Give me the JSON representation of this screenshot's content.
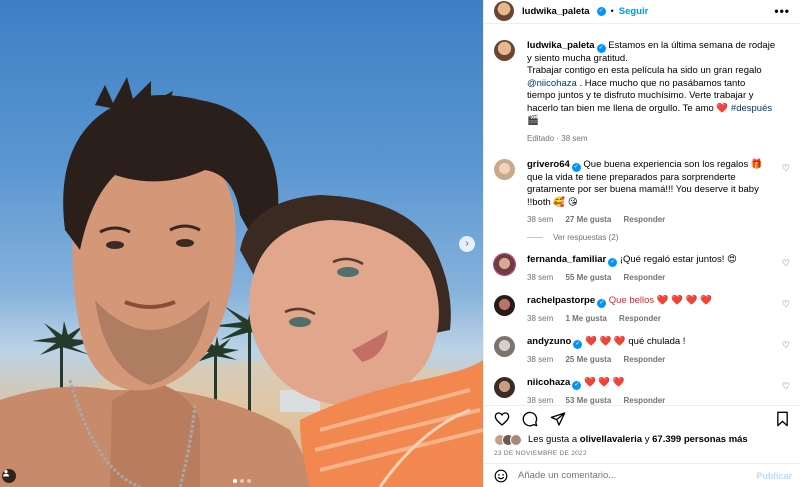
{
  "post": {
    "author": "ludwika_paleta",
    "separator": "•",
    "follow_label": "Seguir",
    "more_label": "•••",
    "caption_parts": {
      "text1": "Estamos en la última semana de rodaje y siento mucha gratitud.",
      "text2": "Trabajar contigo en esta película ha sido un gran regalo",
      "mention": "@niicohaza",
      "text3": ". Hace mucho que no pasábamos tanto tiempo juntos y te disfruto muchísimo. Verte trabajar y hacerlo tan bien me llena de orgullo. Te amo",
      "heart": "❤️",
      "hashtag": "#después",
      "emoji": "🎬"
    },
    "caption_meta": "Editado · 38 sem"
  },
  "comments": [
    {
      "user": "grivero64",
      "text": "Que buena experiencia son los regalos 🎁 que la vida te tiene preparados para sorprenderte gratamente por ser buena mamá!!! You deserve it baby !!both 🥰 😘",
      "time": "38 sem",
      "likes": "27 Me gusta",
      "reply": "Responder",
      "replies": "Ver respuestas (2)"
    },
    {
      "user": "fernanda_familiar",
      "text": "¡Qué regaló estar juntos! 😍",
      "time": "38 sem",
      "likes": "55 Me gusta",
      "reply": "Responder"
    },
    {
      "user": "rachelpastorpe",
      "text": "Que bellos ❤️ ❤️ ❤️ ❤️",
      "time": "38 sem",
      "likes": "1 Me gusta",
      "reply": "Responder"
    },
    {
      "user": "andyzuno",
      "text": "❤️ ❤️ ❤️ qué chulada !",
      "time": "38 sem",
      "likes": "25 Me gusta",
      "reply": "Responder"
    },
    {
      "user": "niicohaza",
      "text": "❤️ ❤️ ❤️",
      "time": "38 sem",
      "likes": "53 Me gusta",
      "reply": "Responder"
    }
  ],
  "likes": {
    "prefix": "Les gusta a",
    "first_user": "olivellavaleria",
    "connector": "y",
    "count": "67.399 personas más"
  },
  "date": "23 DE NOVIEMBRE DE 2022",
  "add_comment": {
    "placeholder": "Añade un comentario...",
    "publish_label": "Publicar"
  },
  "icons": {
    "like": "heart-outline-icon",
    "comment": "comment-bubble-icon",
    "share": "paper-plane-icon",
    "save": "bookmark-icon",
    "emoji": "smiley-icon",
    "next": "chevron-right-icon",
    "tag": "user-tag-icon"
  },
  "colors": {
    "accent": "#0095f6",
    "link": "#00376b",
    "muted": "#737373",
    "heart": "#e0262c"
  },
  "carousel": {
    "total_slides": 3,
    "current_slide": 1
  }
}
